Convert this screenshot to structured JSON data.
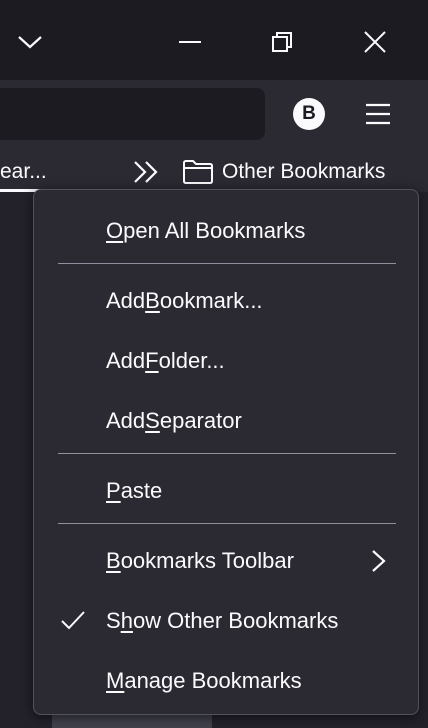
{
  "bookmarks_bar": {
    "truncated_item": "ear...",
    "other_bookmarks": "Other Bookmarks"
  },
  "profile": {
    "initial": "B"
  },
  "menu": {
    "items": [
      {
        "pre": "",
        "key": "O",
        "post": "pen All Bookmarks"
      },
      {
        "pre": "Add ",
        "key": "B",
        "post": "ookmark..."
      },
      {
        "pre": "Add ",
        "key": "F",
        "post": "older..."
      },
      {
        "pre": "Add ",
        "key": "S",
        "post": "eparator"
      },
      {
        "pre": "",
        "key": "P",
        "post": "aste"
      },
      {
        "pre": "",
        "key": "B",
        "post": "ookmarks Toolbar"
      },
      {
        "pre": "S",
        "key": "h",
        "post": "ow Other Bookmarks"
      },
      {
        "pre": "",
        "key": "M",
        "post": "anage Bookmarks"
      }
    ]
  },
  "icons": {
    "collapse": "chevron-down-icon",
    "minimize": "minimize-icon",
    "restore": "restore-icon",
    "close": "close-icon",
    "menu": "hamburger-icon",
    "overflow": "double-chevron-icon",
    "folder": "folder-icon",
    "check": "checkmark-icon",
    "submenu": "chevron-right-icon"
  },
  "colors": {
    "background": "#1c1b22",
    "toolbar": "#2b2a33",
    "menu_bg": "#2b2a33",
    "text": "#fbfbfe",
    "separator": "#8f8f9d"
  }
}
